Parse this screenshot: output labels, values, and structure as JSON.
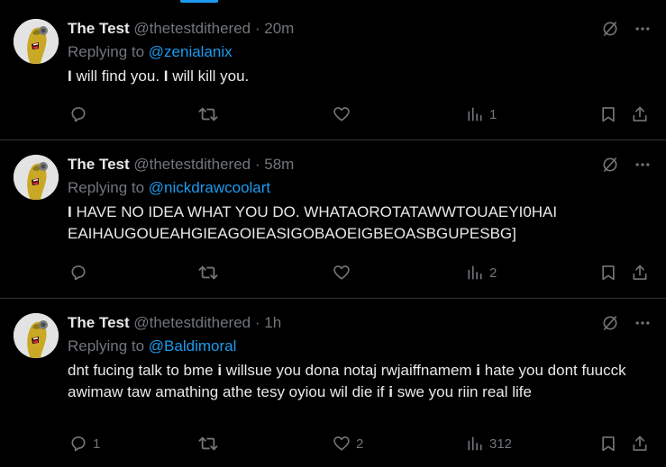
{
  "colors": {
    "background": "#000000",
    "text": "#e7e9ea",
    "muted": "#71767b",
    "accent": "#1d9bf0",
    "divider": "#2f3336"
  },
  "icons": {
    "analyze": "grok-analyze-icon",
    "more": "more-dots-icon",
    "reply": "reply-bubble-icon",
    "retweet": "retweet-icon",
    "like": "heart-icon",
    "views": "views-bar-icon",
    "bookmark": "bookmark-icon",
    "share": "share-icon"
  },
  "tweets": [
    {
      "name": "The Test",
      "handle": "@thetestdithered",
      "dot": "·",
      "time": "20m",
      "reply_prefix": "Replying to ",
      "reply_to": "@zenialanix",
      "text_segments": [
        {
          "t": "I",
          "b": true
        },
        {
          "t": " will find you. ",
          "b": false
        },
        {
          "t": "I",
          "b": true
        },
        {
          "t": " will kill you.",
          "b": false
        }
      ],
      "replies": "",
      "retweets": "",
      "likes": "",
      "views": "1"
    },
    {
      "name": "The Test",
      "handle": "@thetestdithered",
      "dot": "·",
      "time": "58m",
      "reply_prefix": "Replying to ",
      "reply_to": "@nickdrawcoolart",
      "text_segments": [
        {
          "t": "I",
          "b": true
        },
        {
          "t": " HAVE NO IDEA WHAT YOU DO. WHATAOROTATAWWTOUAEYI0HAI EAIHAUGOUEAHGIEAGOIEASIGOBAOEIGBEOASBGUPESBG]",
          "b": false
        }
      ],
      "replies": "",
      "retweets": "",
      "likes": "",
      "views": "2"
    },
    {
      "name": "The Test",
      "handle": "@thetestdithered",
      "dot": "·",
      "time": "1h",
      "reply_prefix": "Replying to ",
      "reply_to": "@Baldimoral",
      "text_segments": [
        {
          "t": "dnt fucing talk to bme ",
          "b": false
        },
        {
          "t": "i",
          "b": true
        },
        {
          "t": " willsue you dona notaj rwjaiffnamem ",
          "b": false
        },
        {
          "t": "i",
          "b": true
        },
        {
          "t": " hate you dont fuucck awimaw taw amathing athe tesy oyiou wil die if ",
          "b": false
        },
        {
          "t": "i",
          "b": true
        },
        {
          "t": " swe you riin real life",
          "b": false
        }
      ],
      "replies": "1",
      "retweets": "",
      "likes": "2",
      "views": "312"
    }
  ]
}
